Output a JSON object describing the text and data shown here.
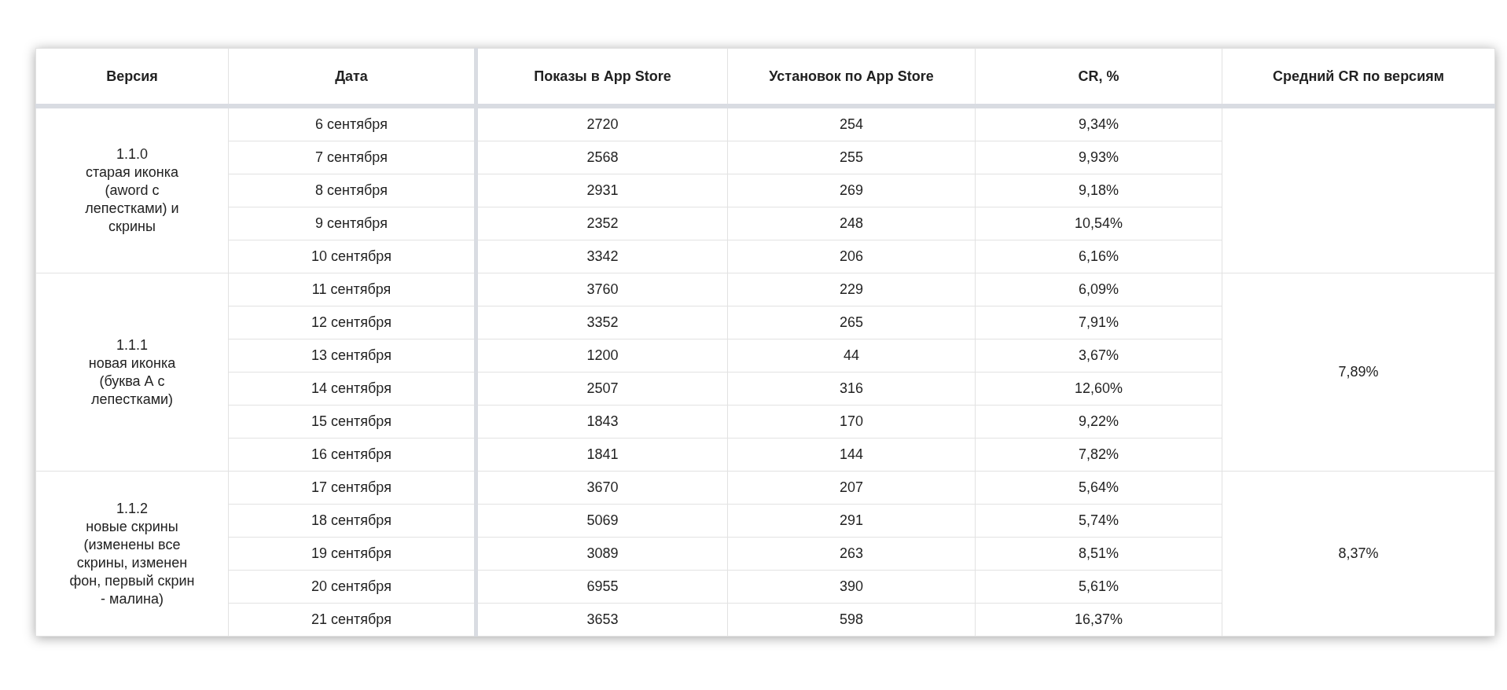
{
  "columns": [
    "Версия",
    "Дата",
    "Показы в App Store",
    "Установок по App Store",
    "CR, %",
    "Средний CR по версиям"
  ],
  "groups": [
    {
      "version": "1.1.0\nстарая иконка\n(aword с\nлепестками) и\nскрины",
      "rows": [
        {
          "date": "6 сентября",
          "shows": "2720",
          "installs": "254",
          "cr": "9,34%"
        },
        {
          "date": "7 сентября",
          "shows": "2568",
          "installs": "255",
          "cr": "9,93%"
        },
        {
          "date": "8 сентября",
          "shows": "2931",
          "installs": "269",
          "cr": "9,18%"
        },
        {
          "date": "9 сентября",
          "shows": "2352",
          "installs": "248",
          "cr": "10,54%"
        },
        {
          "date": "10 сентября",
          "shows": "3342",
          "installs": "206",
          "cr": "6,16%"
        }
      ]
    },
    {
      "version": "1.1.1\nновая иконка\n(буква А с\nлепестками)",
      "average": "7,89%",
      "rows": [
        {
          "date": "11 сентября",
          "shows": "3760",
          "installs": "229",
          "cr": "6,09%"
        },
        {
          "date": "12 сентября",
          "shows": "3352",
          "installs": "265",
          "cr": "7,91%"
        },
        {
          "date": "13 сентября",
          "shows": "1200",
          "installs": "44",
          "cr": "3,67%"
        },
        {
          "date": "14 сентября",
          "shows": "2507",
          "installs": "316",
          "cr": "12,60%"
        },
        {
          "date": "15 сентября",
          "shows": "1843",
          "installs": "170",
          "cr": "9,22%"
        },
        {
          "date": "16 сентября",
          "shows": "1841",
          "installs": "144",
          "cr": "7,82%"
        }
      ]
    },
    {
      "version": "1.1.2\nновые скрины\n(изменены все\nскрины, изменен\nфон, первый скрин\n- малина)",
      "average": "8,37%",
      "rows": [
        {
          "date": "17 сентября",
          "shows": "3670",
          "installs": "207",
          "cr": "5,64%"
        },
        {
          "date": "18 сентября",
          "shows": "5069",
          "installs": "291",
          "cr": "5,74%"
        },
        {
          "date": "19 сентября",
          "shows": "3089",
          "installs": "263",
          "cr": "8,51%"
        },
        {
          "date": "20 сентября",
          "shows": "6955",
          "installs": "390",
          "cr": "5,61%"
        },
        {
          "date": "21 сентября",
          "shows": "3653",
          "installs": "598",
          "cr": "16,37%"
        }
      ]
    }
  ]
}
